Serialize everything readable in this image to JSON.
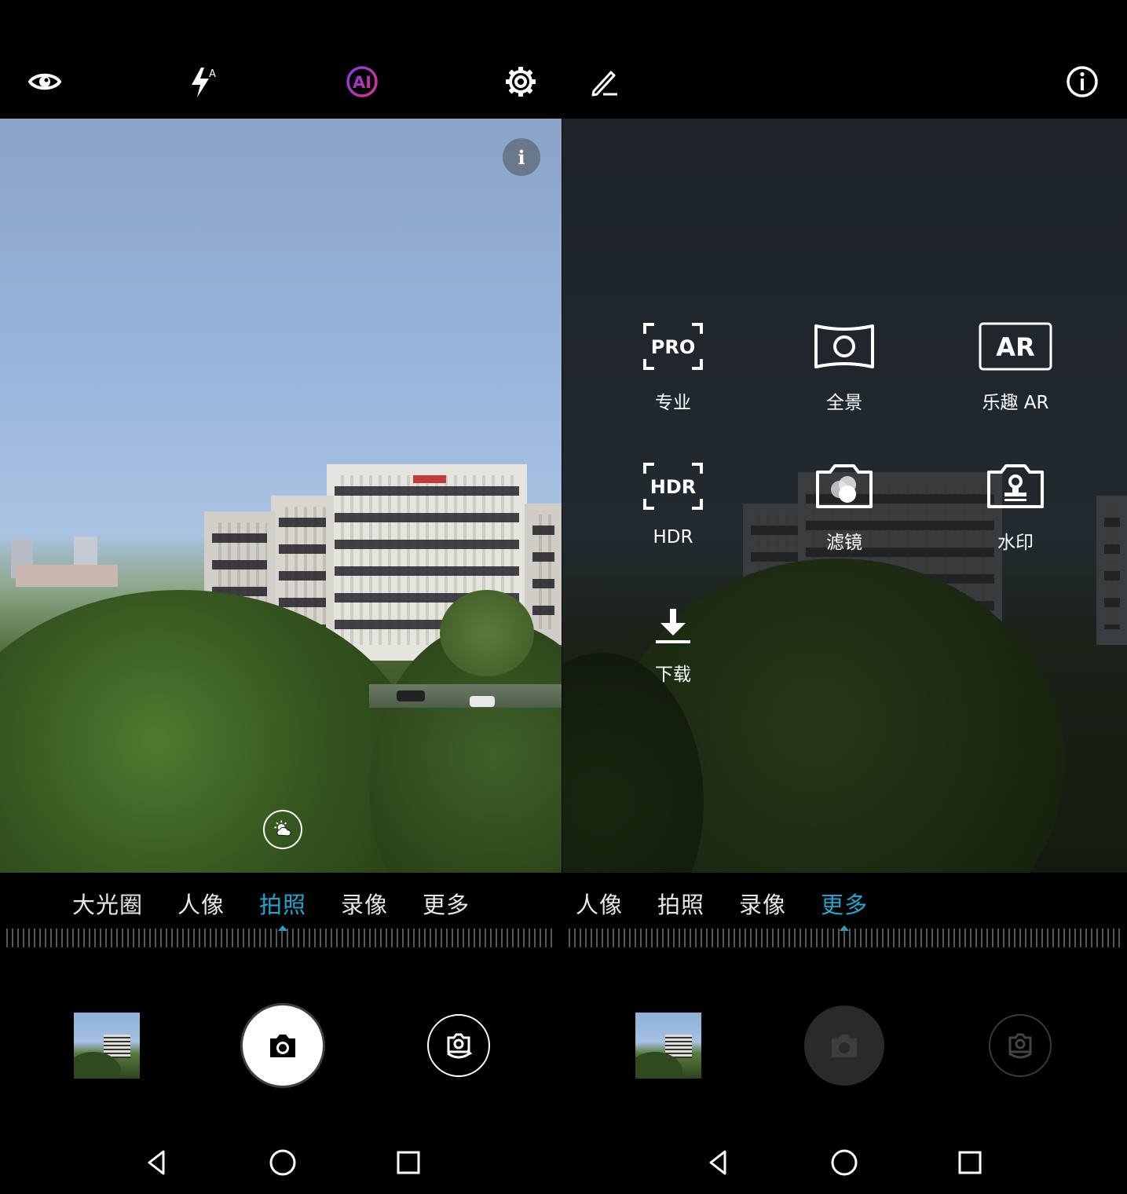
{
  "left": {
    "modes": [
      "大光圈",
      "人像",
      "拍照",
      "录像",
      "更多"
    ],
    "active_mode": "拍照",
    "info_glyph": "i"
  },
  "right": {
    "modes": [
      "人像",
      "拍照",
      "录像",
      "更多"
    ],
    "active_mode": "更多",
    "more_items": [
      {
        "label": "专业",
        "icon": "pro-icon"
      },
      {
        "label": "全景",
        "icon": "panorama-icon"
      },
      {
        "label": "乐趣 AR",
        "icon": "ar-icon"
      },
      {
        "label": "HDR",
        "icon": "hdr-icon"
      },
      {
        "label": "滤镜",
        "icon": "filter-icon"
      },
      {
        "label": "水印",
        "icon": "watermark-icon"
      },
      {
        "label": "下载",
        "icon": "download-icon"
      }
    ],
    "icon_text": {
      "pro": "PRO",
      "hdr": "HDR",
      "ar": "AR"
    }
  },
  "top_icons": {
    "ai_label": "AI",
    "flash_mode": "A"
  },
  "colors": {
    "accent": "#1ea6cf",
    "ai_gradient_start": "#7b3fe4",
    "ai_gradient_end": "#e0308a"
  }
}
